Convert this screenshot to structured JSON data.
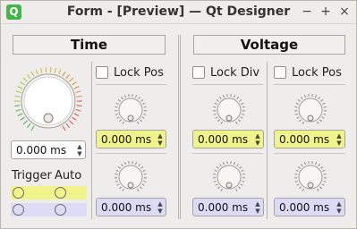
{
  "window": {
    "title": "Form - [Preview] — Qt Designer",
    "app_icon_letter": "Q",
    "minimize_glyph": "−",
    "maximize_glyph": "+",
    "close_glyph": "×"
  },
  "time": {
    "header": "Time",
    "lock_pos_label": "Lock Pos",
    "big_knob_value": "0.000 ms",
    "knob1_value": "0.000 ms",
    "knob2_value": "0.000 ms",
    "trigger_label": "Trigger",
    "auto_label": "Auto"
  },
  "voltage": {
    "header": "Voltage",
    "lock_div_label": "Lock Div",
    "lock_pos_label": "Lock Pos",
    "left_knob1_value": "0.000 ms",
    "left_knob2_value": "0.000 ms",
    "right_knob1_value": "0.000 ms",
    "right_knob2_value": "0.000 ms"
  },
  "colors": {
    "accent_yellow": "#f0f28a",
    "accent_blue": "#dbdbf7",
    "qt_green": "#45b549"
  },
  "icons": {
    "spin_up": "▲",
    "spin_down": "▼"
  }
}
